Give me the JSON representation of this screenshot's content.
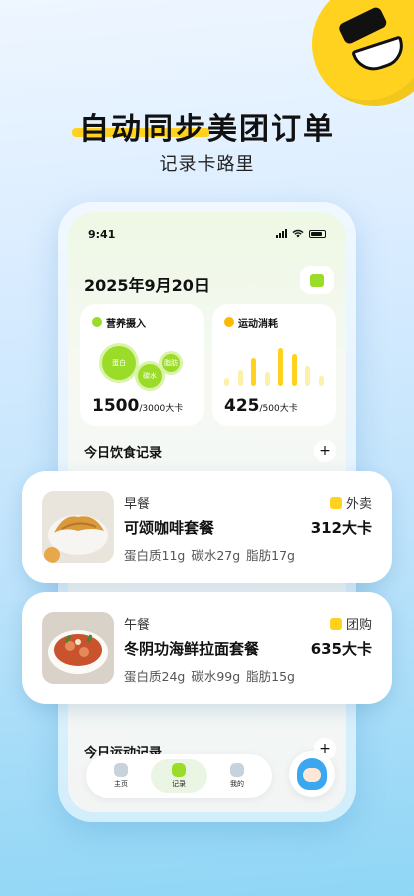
{
  "headline": "自动同步美团订单",
  "subheadline": "记录卡路里",
  "phone": {
    "status_time": "9:41",
    "date": "2025年9月20日",
    "nutrition": {
      "title": "营养摄入",
      "value": "1500",
      "target": "/3000大卡",
      "bubbles": [
        "蛋白",
        "碳水",
        "脂肪"
      ]
    },
    "exercise": {
      "title": "运动消耗",
      "value": "425",
      "target": "/500大卡"
    },
    "food_section_title": "今日饮食记录",
    "sport_section_title": "今日运动记录",
    "tabs": [
      {
        "label": "主页"
      },
      {
        "label": "记录"
      },
      {
        "label": "我的"
      }
    ]
  },
  "meals": [
    {
      "type": "早餐",
      "name": "可颂咖啡套餐",
      "kcal": "312大卡",
      "source": "外卖",
      "protein": "蛋白质11g",
      "carbs": "碳水27g",
      "fat": "脂肪17g"
    },
    {
      "type": "午餐",
      "name": "冬阴功海鲜拉面套餐",
      "kcal": "635大卡",
      "source": "团购",
      "protein": "蛋白质24g",
      "carbs": "碳水99g",
      "fat": "脂肪15g"
    }
  ],
  "colors": {
    "accent_green": "#9bdc28",
    "brand_yellow": "#ffd21f",
    "bar_yellow": "#ffd21f",
    "bar_light": "#fdf0a8"
  }
}
